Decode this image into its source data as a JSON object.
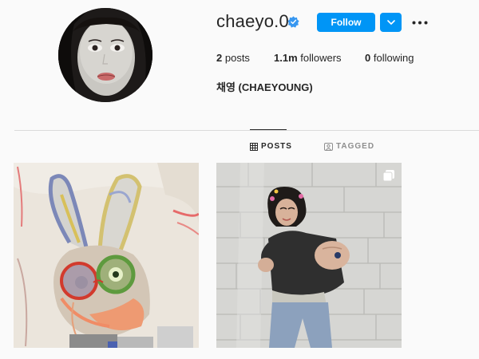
{
  "profile": {
    "username": "chaeyo.0",
    "full_name": "채영 (CHAEYOUNG)",
    "verified_icon": "verified-badge-icon",
    "stats": {
      "posts_value": "2",
      "posts_label": "posts",
      "followers_value": "1.1m",
      "followers_label": "followers",
      "following_value": "0",
      "following_label": "following"
    }
  },
  "actions": {
    "follow_label": "Follow",
    "dropdown_icon": "chevron-down-icon",
    "more_icon": "more-options-icon"
  },
  "tabs": [
    {
      "label": "POSTS",
      "icon": "grid-icon",
      "active": true
    },
    {
      "label": "TAGGED",
      "icon": "tagged-icon",
      "active": false
    }
  ],
  "posts": [
    {
      "kind": "image",
      "description_icon": "drawing-rabbit"
    },
    {
      "kind": "carousel",
      "description_icon": "multi-photo-icon"
    }
  ],
  "colors": {
    "accent": "#0095f6",
    "text": "#262626",
    "muted": "#8e8e8e",
    "border": "#dbdbdb",
    "background": "#fafafa"
  }
}
